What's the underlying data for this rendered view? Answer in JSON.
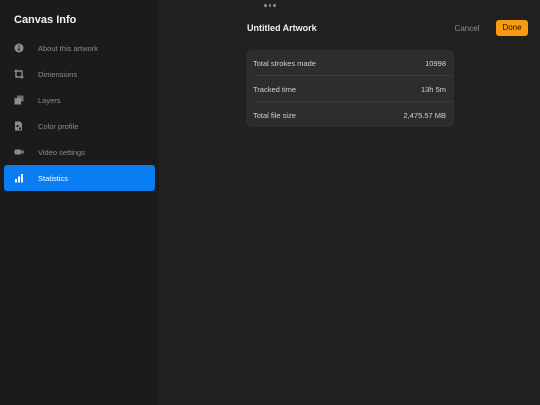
{
  "sidebar": {
    "title": "Canvas Info",
    "items": [
      {
        "label": "About this artwork",
        "icon": "info-icon"
      },
      {
        "label": "Dimensions",
        "icon": "crop-icon"
      },
      {
        "label": "Layers",
        "icon": "layers-icon"
      },
      {
        "label": "Color profile",
        "icon": "color-profile-icon"
      },
      {
        "label": "Video settings",
        "icon": "video-camera-icon"
      },
      {
        "label": "Statistics",
        "icon": "bar-chart-icon",
        "active": true
      }
    ]
  },
  "header": {
    "title": "Untitled Artwork",
    "cancel_label": "Cancel",
    "done_label": "Done"
  },
  "statistics": [
    {
      "label": "Total strokes made",
      "value": "10998"
    },
    {
      "label": "Tracked time",
      "value": "13h 5m"
    },
    {
      "label": "Total file size",
      "value": "2,475.57 MB"
    }
  ],
  "colors": {
    "accent": "#0a7df2",
    "done": "#f79c0e",
    "background": "#212121",
    "sidebar": "#1b1b1b"
  }
}
